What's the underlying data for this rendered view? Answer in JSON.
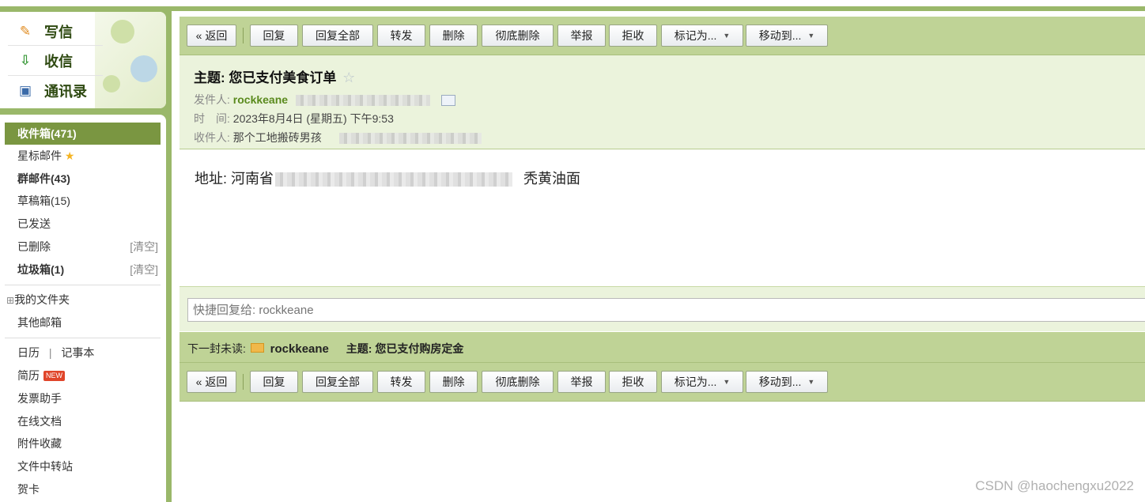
{
  "quick_links": {
    "compose": "写信",
    "receive": "收信",
    "contacts": "通讯录"
  },
  "folders": {
    "inbox": "收件箱(471)",
    "starred": "星标邮件",
    "group": "群邮件(43)",
    "drafts": "草稿箱(15)",
    "sent": "已发送",
    "deleted": "已删除",
    "deleted_action": "[清空]",
    "spam": "垃圾箱(1)",
    "spam_action": "[清空]",
    "my_folders": "我的文件夹",
    "other_mailboxes": "其他邮箱",
    "calendar": "日历",
    "divider": "|",
    "notebook": "记事本",
    "resume": "简历",
    "new_badge": "NEW",
    "invoice": "发票助手",
    "online_docs": "在线文档",
    "attachments": "附件收藏",
    "file_transfer": "文件中转站",
    "cards": "贺卡"
  },
  "toolbar": {
    "back": "« 返回",
    "reply": "回复",
    "reply_all": "回复全部",
    "forward": "转发",
    "delete": "删除",
    "delete_forever": "彻底删除",
    "report": "举报",
    "reject": "拒收",
    "mark_as": "标记为...",
    "move_to": "移动到..."
  },
  "mail": {
    "subject_label": "主题:",
    "subject": "您已支付美食订单",
    "from_label": "发件人:",
    "from": "rockkeane",
    "time_label": "时　间:",
    "time": "2023年8月4日 (星期五) 下午9:53",
    "to_label": "收件人:",
    "to": "那个工地搬砖男孩",
    "body_prefix": "地址: 河南省",
    "body_suffix": "秃黄油面"
  },
  "quick_reply": {
    "placeholder": "快捷回复给: rockkeane"
  },
  "next_unread": {
    "label": "下一封未读:",
    "from": "rockkeane",
    "subject_label": "主题:",
    "subject": "您已支付购房定金"
  },
  "watermark": "CSDN @haochengxu2022"
}
